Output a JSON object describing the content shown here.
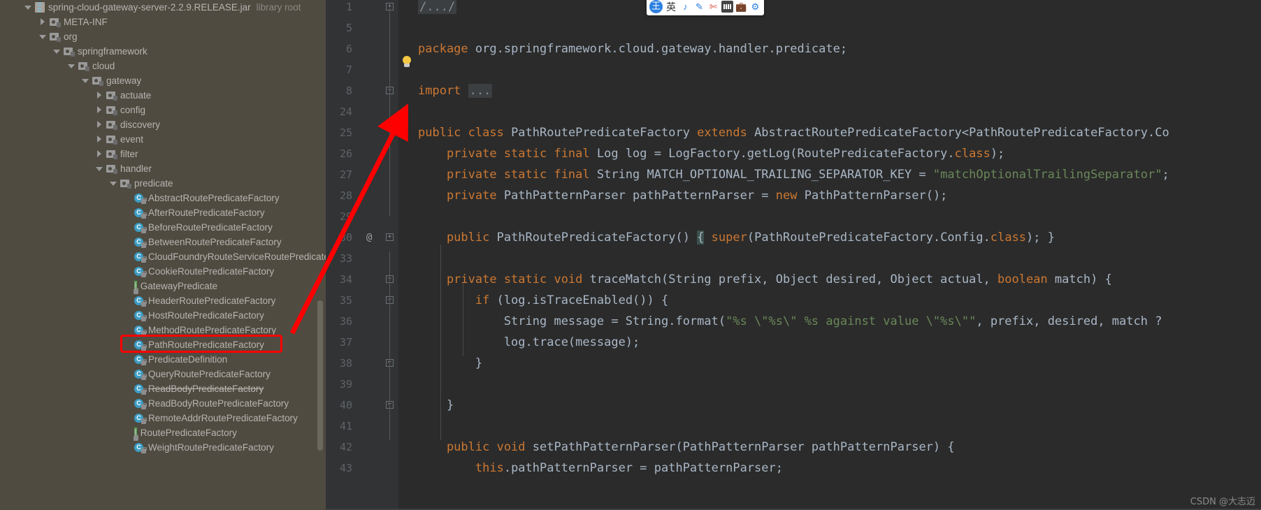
{
  "app": "IntelliJ IDEA - Java decompiled class viewer",
  "sidebar": {
    "name": "project-tree",
    "scrollbar": true,
    "nodes": [
      {
        "label": "spring-cloud-gateway-server-2.2.9.RELEASE.jar",
        "suffix": "library root",
        "icon": "jar-icon",
        "arrow": "down",
        "indent": 0
      },
      {
        "label": "META-INF",
        "icon": "package-icon",
        "arrow": "right",
        "indent": 1
      },
      {
        "label": "org",
        "icon": "package-icon",
        "arrow": "down",
        "indent": 1
      },
      {
        "label": "springframework",
        "icon": "package-icon",
        "arrow": "down",
        "indent": 2
      },
      {
        "label": "cloud",
        "icon": "package-icon",
        "arrow": "down",
        "indent": 3
      },
      {
        "label": "gateway",
        "icon": "package-icon",
        "arrow": "down",
        "indent": 4
      },
      {
        "label": "actuate",
        "icon": "package-icon",
        "arrow": "right",
        "indent": 5
      },
      {
        "label": "config",
        "icon": "package-icon",
        "arrow": "right",
        "indent": 5
      },
      {
        "label": "discovery",
        "icon": "package-icon",
        "arrow": "right",
        "indent": 5
      },
      {
        "label": "event",
        "icon": "package-icon",
        "arrow": "right",
        "indent": 5
      },
      {
        "label": "filter",
        "icon": "package-icon",
        "arrow": "right",
        "indent": 5
      },
      {
        "label": "handler",
        "icon": "package-icon",
        "arrow": "down",
        "indent": 5
      },
      {
        "label": "predicate",
        "icon": "package-icon",
        "arrow": "down",
        "indent": 6
      },
      {
        "label": "AbstractRoutePredicateFactory",
        "icon": "class-icon",
        "arrow": "none",
        "indent": 7
      },
      {
        "label": "AfterRoutePredicateFactory",
        "icon": "class-icon",
        "arrow": "none",
        "indent": 7
      },
      {
        "label": "BeforeRoutePredicateFactory",
        "icon": "class-icon",
        "arrow": "none",
        "indent": 7
      },
      {
        "label": "BetweenRoutePredicateFactory",
        "icon": "class-icon",
        "arrow": "none",
        "indent": 7
      },
      {
        "label": "CloudFoundryRouteServiceRoutePredicateFactory",
        "icon": "class-icon",
        "arrow": "none",
        "indent": 7
      },
      {
        "label": "CookieRoutePredicateFactory",
        "icon": "class-icon",
        "arrow": "none",
        "indent": 7
      },
      {
        "label": "GatewayPredicate",
        "icon": "interface-icon",
        "arrow": "none",
        "indent": 7
      },
      {
        "label": "HeaderRoutePredicateFactory",
        "icon": "class-icon",
        "arrow": "none",
        "indent": 7
      },
      {
        "label": "HostRoutePredicateFactory",
        "icon": "class-icon",
        "arrow": "none",
        "indent": 7
      },
      {
        "label": "MethodRoutePredicateFactory",
        "icon": "class-icon",
        "arrow": "none",
        "indent": 7
      },
      {
        "label": "PathRoutePredicateFactory",
        "icon": "class-icon",
        "arrow": "none",
        "indent": 7,
        "highlighted": true
      },
      {
        "label": "PredicateDefinition",
        "icon": "class-icon",
        "arrow": "none",
        "indent": 7
      },
      {
        "label": "QueryRoutePredicateFactory",
        "icon": "class-icon",
        "arrow": "none",
        "indent": 7
      },
      {
        "label": "ReadBodyPredicateFactory",
        "icon": "class-icon",
        "arrow": "none",
        "indent": 7,
        "deprecated": true
      },
      {
        "label": "ReadBodyRoutePredicateFactory",
        "icon": "class-icon",
        "arrow": "none",
        "indent": 7
      },
      {
        "label": "RemoteAddrRoutePredicateFactory",
        "icon": "class-icon",
        "arrow": "none",
        "indent": 7
      },
      {
        "label": "RoutePredicateFactory",
        "icon": "interface-icon",
        "arrow": "none",
        "indent": 7
      },
      {
        "label": "WeightRoutePredicateFactory",
        "icon": "class-icon",
        "arrow": "none",
        "indent": 7
      }
    ]
  },
  "editor": {
    "name": "code-editor",
    "language": "java",
    "gutter_numbers": [
      "1",
      "5",
      "6",
      "7",
      "8",
      "24",
      "25",
      "26",
      "27",
      "28",
      "29",
      "30",
      "33",
      "34",
      "35",
      "36",
      "37",
      "38",
      "39",
      "40",
      "41",
      "42",
      "43"
    ],
    "annotation_marker": "@",
    "lines": [
      {
        "num": "1",
        "tokens": [
          {
            "t": "fold",
            "v": "/.../"
          }
        ]
      },
      {
        "num": "5",
        "tokens": []
      },
      {
        "num": "6",
        "tokens": [
          {
            "t": "kw",
            "v": "package"
          },
          {
            "t": "def",
            "v": " org.springframework.cloud.gateway.handler.predicate;"
          }
        ]
      },
      {
        "num": "7",
        "tokens": []
      },
      {
        "num": "8",
        "tokens": [
          {
            "t": "kw",
            "v": "import"
          },
          {
            "t": "def",
            "v": " "
          },
          {
            "t": "fold",
            "v": "..."
          }
        ]
      },
      {
        "num": "24",
        "tokens": []
      },
      {
        "num": "25",
        "tokens": [
          {
            "t": "kw",
            "v": "public class"
          },
          {
            "t": "def",
            "v": " PathRoutePredicateFactory "
          },
          {
            "t": "kw",
            "v": "extends"
          },
          {
            "t": "def",
            "v": " AbstractRoutePredicateFactory<PathRoutePredicateFactory.Co"
          }
        ]
      },
      {
        "num": "26",
        "tokens": [
          {
            "t": "kw",
            "v": "    private static final"
          },
          {
            "t": "def",
            "v": " Log log = LogFactory.getLog(RoutePredicateFactory."
          },
          {
            "t": "kw",
            "v": "class"
          },
          {
            "t": "def",
            "v": ");"
          }
        ]
      },
      {
        "num": "27",
        "tokens": [
          {
            "t": "kw",
            "v": "    private static final"
          },
          {
            "t": "def",
            "v": " String MATCH_OPTIONAL_TRAILING_SEPARATOR_KEY = "
          },
          {
            "t": "str",
            "v": "\"matchOptionalTrailingSeparator\""
          },
          {
            "t": "def",
            "v": ";"
          }
        ]
      },
      {
        "num": "28",
        "tokens": [
          {
            "t": "kw",
            "v": "    private"
          },
          {
            "t": "def",
            "v": " PathPatternParser pathPatternParser = "
          },
          {
            "t": "kw",
            "v": "new"
          },
          {
            "t": "def",
            "v": " PathPatternParser();"
          }
        ]
      },
      {
        "num": "29",
        "tokens": []
      },
      {
        "num": "30",
        "tokens": [
          {
            "t": "kw",
            "v": "    public"
          },
          {
            "t": "def",
            "v": " PathRoutePredicateFactory() "
          },
          {
            "t": "hl",
            "v": "{"
          },
          {
            "t": "def",
            "v": " "
          },
          {
            "t": "kw",
            "v": "super"
          },
          {
            "t": "def",
            "v": "(PathRoutePredicateFactory.Config."
          },
          {
            "t": "kw",
            "v": "class"
          },
          {
            "t": "def",
            "v": "); }"
          }
        ]
      },
      {
        "num": "33",
        "tokens": []
      },
      {
        "num": "34",
        "tokens": [
          {
            "t": "kw",
            "v": "    private static void"
          },
          {
            "t": "def",
            "v": " traceMatch(String prefix, Object desired, Object actual, "
          },
          {
            "t": "kw",
            "v": "boolean"
          },
          {
            "t": "def",
            "v": " match) {"
          }
        ]
      },
      {
        "num": "35",
        "tokens": [
          {
            "t": "kw",
            "v": "        if"
          },
          {
            "t": "def",
            "v": " (log.isTraceEnabled()) {"
          }
        ]
      },
      {
        "num": "36",
        "tokens": [
          {
            "t": "def",
            "v": "            String message = String.format("
          },
          {
            "t": "str",
            "v": "\"%s \\\"%s\\\" %s against value \\\"%s\\\"\""
          },
          {
            "t": "def",
            "v": ", prefix, desired, match ?"
          }
        ]
      },
      {
        "num": "37",
        "tokens": [
          {
            "t": "def",
            "v": "            log.trace(message);"
          }
        ]
      },
      {
        "num": "38",
        "tokens": [
          {
            "t": "def",
            "v": "        }"
          }
        ]
      },
      {
        "num": "39",
        "tokens": []
      },
      {
        "num": "40",
        "tokens": [
          {
            "t": "def",
            "v": "    }"
          }
        ]
      },
      {
        "num": "41",
        "tokens": []
      },
      {
        "num": "42",
        "tokens": [
          {
            "t": "kw",
            "v": "    public void"
          },
          {
            "t": "def",
            "v": " setPathPatternParser(PathPatternParser pathPatternParser) {"
          }
        ]
      },
      {
        "num": "43",
        "tokens": [
          {
            "t": "kw",
            "v": "        this"
          },
          {
            "t": "def",
            "v": ".pathPatternParser = pathPatternParser;"
          }
        ]
      }
    ]
  },
  "ime_toolbar": {
    "name": "chinese-ime-toolbar",
    "logo": "王",
    "mode_label": "英",
    "items": [
      {
        "icon": "sogou-logo-icon",
        "label": "王"
      },
      {
        "icon": "language-mode-icon",
        "label": "英"
      },
      {
        "icon": "voice-input-icon",
        "label": ""
      },
      {
        "icon": "handwriting-pen-icon",
        "label": ""
      },
      {
        "icon": "scissors-screenshot-icon",
        "label": ""
      },
      {
        "icon": "soft-keyboard-icon",
        "label": ""
      },
      {
        "icon": "toolbox-icon",
        "label": ""
      },
      {
        "icon": "gear-icon",
        "label": ""
      }
    ]
  },
  "annotations": {
    "highlight_box": {
      "name": "red-highlight-box",
      "target": "PathRoutePredicateFactory",
      "color": "#fe0000"
    },
    "arrow": {
      "name": "red-pointer-arrow",
      "from": "PathRoutePredicateFactory tree node",
      "to": "public class PathRoutePredicateFactory",
      "color": "#fe0000"
    }
  },
  "watermark": {
    "name": "csdn-watermark",
    "text": "CSDN @大志迈"
  }
}
